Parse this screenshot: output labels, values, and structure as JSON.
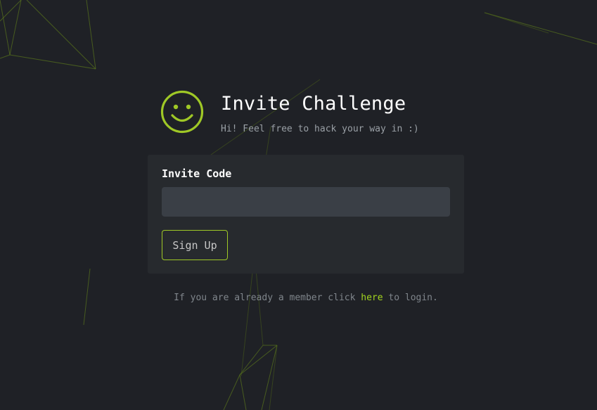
{
  "header": {
    "title": "Invite Challenge",
    "subtitle": "Hi! Feel free to hack your way in :)"
  },
  "form": {
    "invite_label": "Invite Code",
    "invite_value": "",
    "invite_placeholder": "",
    "submit_label": "Sign Up"
  },
  "footer": {
    "prefix": "If you are already a member click ",
    "link_label": "here",
    "suffix": " to login."
  },
  "colors": {
    "background": "#1f2126",
    "card": "#272a2e",
    "input": "#3a3f46",
    "accent": "#9fc826",
    "link": "#a2d31f"
  },
  "icons": {
    "logo": "smiley-icon"
  }
}
